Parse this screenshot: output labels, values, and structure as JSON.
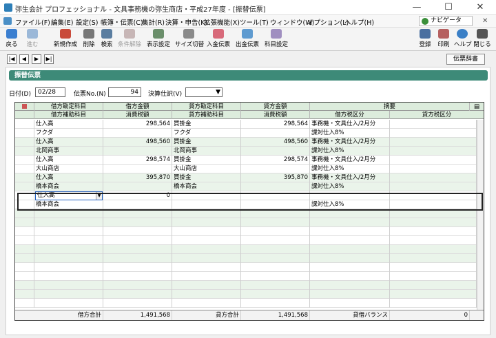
{
  "window": {
    "title": "弥生会計 プロフェッショナル - 文具事務機の弥生商店・平成27年度 - [振替伝票]",
    "min": "—",
    "max": "☐",
    "close": "✕"
  },
  "menu": {
    "items": [
      "ファイル(F)",
      "編集(E)",
      "設定(S)",
      "帳簿・伝票(C)",
      "集計(R)",
      "決算・申告(K)",
      "拡張機能(X)",
      "ツール(T)",
      "ウィンドウ(W)",
      "オプション(L)",
      "ヘルプ(H)"
    ],
    "navi": "ナビゲータ",
    "close_x": "✕"
  },
  "toolbar": {
    "back": "戻る",
    "forward": "進む",
    "new": "新規作成",
    "delete": "削除",
    "search": "検索",
    "cond_delete": "条件解除",
    "display_settings": "表示設定",
    "size_switch": "サイズ切替",
    "deposit_slip": "入金伝票",
    "payment_slip": "出金伝票",
    "account_settings": "科目設定",
    "register": "登録",
    "print": "印刷",
    "help": "ヘルプ",
    "close": "閉じる"
  },
  "nav": {
    "first": "|◀",
    "prev": "◀",
    "next": "▶",
    "last": "▶|",
    "dict": "伝票辞書"
  },
  "panel": {
    "title": "振替伝票"
  },
  "filters": {
    "date_label": "日付(D)",
    "date_value": "02/28",
    "slip_no_label": "伝票No.(N)",
    "slip_no_value": "94",
    "closing_label": "決算仕訳(V)",
    "closing_value": ""
  },
  "grid": {
    "headers1": [
      "借方勘定科目",
      "借方金額",
      "貸方勘定科目",
      "貸方金額",
      "摘要"
    ],
    "headers2": [
      "借方補助科目",
      "消費税額",
      "貸方補助科目",
      "消費税額",
      "借方税区分",
      "貸方税区分"
    ],
    "rows": [
      [
        "仕入高",
        "298,564",
        "買掛金",
        "298,564",
        "事務機・文具仕入/2月分",
        ""
      ],
      [
        "フクダ",
        "",
        "フクダ",
        "",
        "課対仕入8%",
        ""
      ],
      [
        "仕入高",
        "498,560",
        "買掛金",
        "498,560",
        "事務機・文具仕入/2月分",
        ""
      ],
      [
        "北岡商事",
        "",
        "北岡商事",
        "",
        "課対仕入8%",
        ""
      ],
      [
        "仕入高",
        "298,574",
        "買掛金",
        "298,574",
        "事務機・文具仕入/2月分",
        ""
      ],
      [
        "大山商店",
        "",
        "大山商店",
        "",
        "課対仕入8%",
        ""
      ],
      [
        "仕入高",
        "395,870",
        "買掛金",
        "395,870",
        "事務機・文具仕入/2月分",
        ""
      ],
      [
        "橋本商会",
        "",
        "橋本商会",
        "",
        "課対仕入8%",
        ""
      ],
      [
        "仕入高",
        "0",
        "",
        "",
        "",
        ""
      ],
      [
        "橋本商会",
        "",
        "",
        "",
        "課対仕入8%",
        ""
      ]
    ],
    "footer": {
      "debit_total_label": "借方合計",
      "debit_total": "1,491,568",
      "credit_total_label": "貸方合計",
      "credit_total": "1,491,568",
      "balance_label": "貸借バランス",
      "balance": "0"
    }
  }
}
